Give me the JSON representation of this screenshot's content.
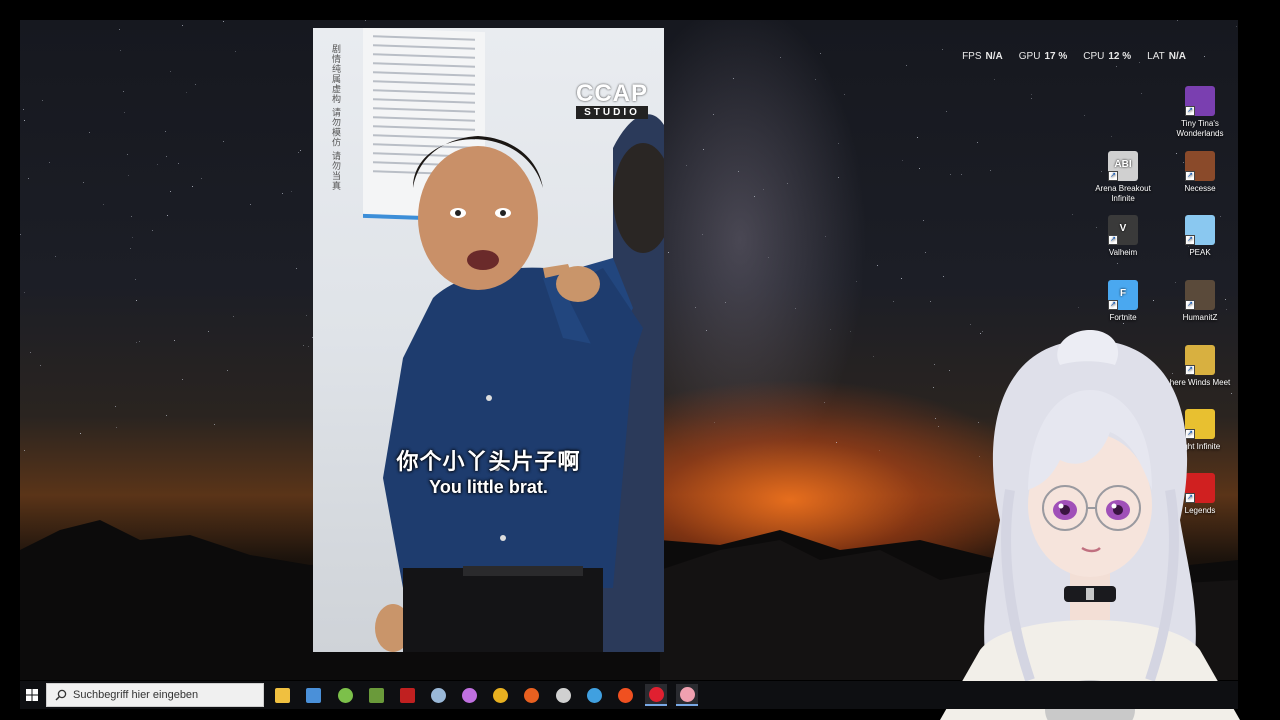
{
  "hud": {
    "fps_label": "FPS",
    "fps_value": "N/A",
    "gpu_label": "GPU",
    "gpu_value": "17 %",
    "cpu_label": "CPU",
    "cpu_value": "12 %",
    "lat_label": "LAT",
    "lat_value": "N/A"
  },
  "desktop_icons": [
    {
      "label": "Tiny Tina's Wonderlands",
      "icon": "tiny-tinas-wonderlands-icon",
      "color": "#7a3fb0"
    },
    {
      "label": "Arena Breakout Infinite",
      "icon": "arena-breakout-infinite-icon",
      "color": "#d0d0d0",
      "badge": "ABI"
    },
    {
      "label": "Necesse",
      "icon": "necesse-icon",
      "color": "#8a4a2a"
    },
    {
      "label": "Valheim",
      "icon": "valheim-icon",
      "color": "#3a3a3a",
      "badge": "V"
    },
    {
      "label": "PEAK",
      "icon": "peak-icon",
      "color": "#8ac8f0"
    },
    {
      "label": "Fortnite",
      "icon": "fortnite-icon",
      "color": "#4aa8f0",
      "badge": "F"
    },
    {
      "label": "HumanitZ",
      "icon": "humanitz-icon",
      "color": "#5a4a3a"
    },
    {
      "label": "here Winds Meet",
      "icon": "where-winds-meet-icon",
      "color": "#d8b040"
    },
    {
      "label": "light Infinite",
      "icon": "light-infinite-icon",
      "color": "#e8c030"
    },
    {
      "label": "Legends",
      "icon": "legends-icon",
      "color": "#d02020"
    }
  ],
  "video": {
    "vertical_caption": "剧情纯属虚构 请勿模仿 请勿当真",
    "logo_top": "CCAP",
    "logo_bottom": "STUDIO",
    "subtitle_cn": "你个小丫头片子啊",
    "subtitle_en": "You little brat."
  },
  "taskbar": {
    "search_placeholder": "Suchbegriff hier eingeben",
    "apps": [
      {
        "name": "file-explorer-icon",
        "color": "#f0c040"
      },
      {
        "name": "store-icon",
        "color": "#4a90d9"
      },
      {
        "name": "android-app-icon",
        "color": "#7cc04a"
      },
      {
        "name": "minecraft-icon",
        "color": "#6a9a3a"
      },
      {
        "name": "game-launcher-icon",
        "color": "#c02020"
      },
      {
        "name": "steam-icon",
        "color": "#9ab8d8"
      },
      {
        "name": "discord-icon",
        "color": "#c070e0"
      },
      {
        "name": "chrome-icon",
        "color": "#e8b020"
      },
      {
        "name": "firefox-icon",
        "color": "#e86020"
      },
      {
        "name": "speedometer-icon",
        "color": "#d0d0d0"
      },
      {
        "name": "link-app-icon",
        "color": "#40a0e0"
      },
      {
        "name": "brave-icon",
        "color": "#f05020"
      },
      {
        "name": "obs-icon",
        "color": "#e02030"
      },
      {
        "name": "vtube-studio-icon",
        "color": "#f0a0b0"
      }
    ]
  }
}
